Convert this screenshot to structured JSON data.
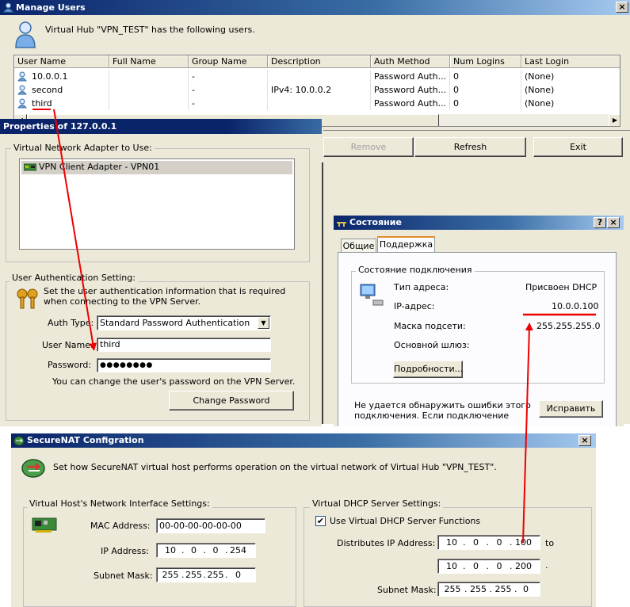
{
  "manage_users": {
    "title": "Manage Users",
    "description": "Virtual Hub \"VPN_TEST\" has the following users.",
    "columns": [
      "User Name",
      "Full Name",
      "Group Name",
      "Description",
      "Auth Method",
      "Num Logins",
      "Last Login"
    ],
    "rows": [
      {
        "user": "10.0.0.1",
        "full": "",
        "group": "-",
        "desc": "",
        "auth": "Password Auth...",
        "logins": "0",
        "last": "(None)"
      },
      {
        "user": "second",
        "full": "",
        "group": "-",
        "desc": "IPv4: 10.0.0.2",
        "auth": "Password Auth...",
        "logins": "0",
        "last": "(None)"
      },
      {
        "user": "third",
        "full": "",
        "group": "-",
        "desc": "",
        "auth": "Password Auth...",
        "logins": "0",
        "last": "(None)"
      }
    ],
    "buttons": {
      "remove": "Remove",
      "refresh": "Refresh",
      "exit": "Exit"
    }
  },
  "properties": {
    "title": "Properties of 127.0.0.1",
    "adapter_group": "Virtual Network Adapter to Use:",
    "adapter_item": "VPN Client Adapter - VPN01",
    "auth_group": "User Authentication Setting:",
    "auth_info": "Set the user authentication information that is required when connecting to the VPN Server.",
    "auth_type_label": "Auth Type:",
    "auth_type_value": "Standard Password Authentication",
    "user_name_label": "User Name:",
    "user_name_value": "third",
    "password_label": "Password:",
    "password_value": "●●●●●●●●",
    "change_hint": "You can change the user's password on the VPN Server.",
    "change_password_button": "Change Password"
  },
  "status": {
    "title": "Состояние",
    "tabs": [
      "Общие",
      "Поддержка"
    ],
    "group": "Состояние подключения",
    "addr_type_label": "Тип адреса:",
    "addr_type_value": "Присвоен DHCP",
    "ip_label": "IP-адрес:",
    "ip_value": "10.0.0.100",
    "mask_label": "Маска подсети:",
    "mask_value": "255.255.255.0",
    "gateway_label": "Основной шлюз:",
    "details_button": "Подробности...",
    "error_text": "Не удается обнаружить ошибки этого подключения. Если подключение",
    "error_text_cut": "...",
    "fix_button": "Исправить"
  },
  "securenat": {
    "title": "SecureNAT Configration",
    "description": "Set how SecureNAT virtual host performs operation on the virtual network of Virtual Hub \"VPN_TEST\".",
    "host_group": "Virtual Host's Network Interface Settings:",
    "mac_label": "MAC Address:",
    "mac_value": "00-00-00-00-00-00",
    "ip_label": "IP Address:",
    "ip_value": [
      "10",
      "0",
      "0",
      "254"
    ],
    "mask_label": "Subnet Mask:",
    "mask_value": [
      "255",
      "255",
      "255",
      "0"
    ],
    "dhcp_group": "Virtual DHCP Server Settings:",
    "use_dhcp_label": "Use Virtual DHCP Server Functions",
    "use_dhcp_checked": true,
    "distributes_label": "Distributes IP Address:",
    "dist_from": [
      "10",
      "0",
      "0",
      "100"
    ],
    "to_label": "to",
    "dist_to": [
      "10",
      "0",
      "0",
      "200"
    ],
    "dot": ".",
    "dhcp_mask_label": "Subnet Mask:",
    "dhcp_mask_value": [
      "255",
      "255",
      "255",
      "0"
    ]
  },
  "colors": {
    "annotation_red": "#ee0000",
    "title_blue": "#0a246a",
    "selection_gray": "#d4d0c8"
  }
}
